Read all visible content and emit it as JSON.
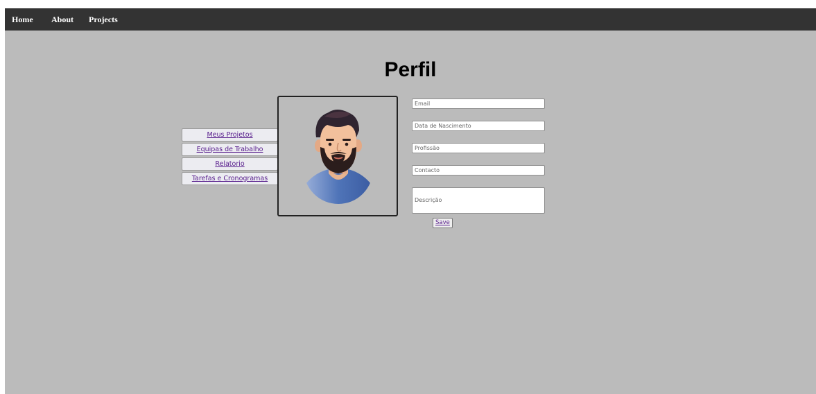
{
  "nav": {
    "home": "Home",
    "about": "About",
    "projects": "Projects"
  },
  "page": {
    "title": "Perfil"
  },
  "sidebar": {
    "items": [
      {
        "label": "Meus Projetos"
      },
      {
        "label": "Equipas de Trabalho"
      },
      {
        "label": "Relatorio"
      },
      {
        "label": "Tarefas e Cronogramas"
      }
    ]
  },
  "form": {
    "email_placeholder": "Email",
    "birthdate_placeholder": "Data de Nascimento",
    "profession_placeholder": "Profissão",
    "contact_placeholder": "Contacto",
    "description_placeholder": "Descrição",
    "save_label": "Save"
  },
  "colors": {
    "navbar": "#333333",
    "background": "#bbbbbb",
    "link": "#551a8b"
  },
  "icons": {
    "avatar": "man-with-beard-avatar"
  }
}
